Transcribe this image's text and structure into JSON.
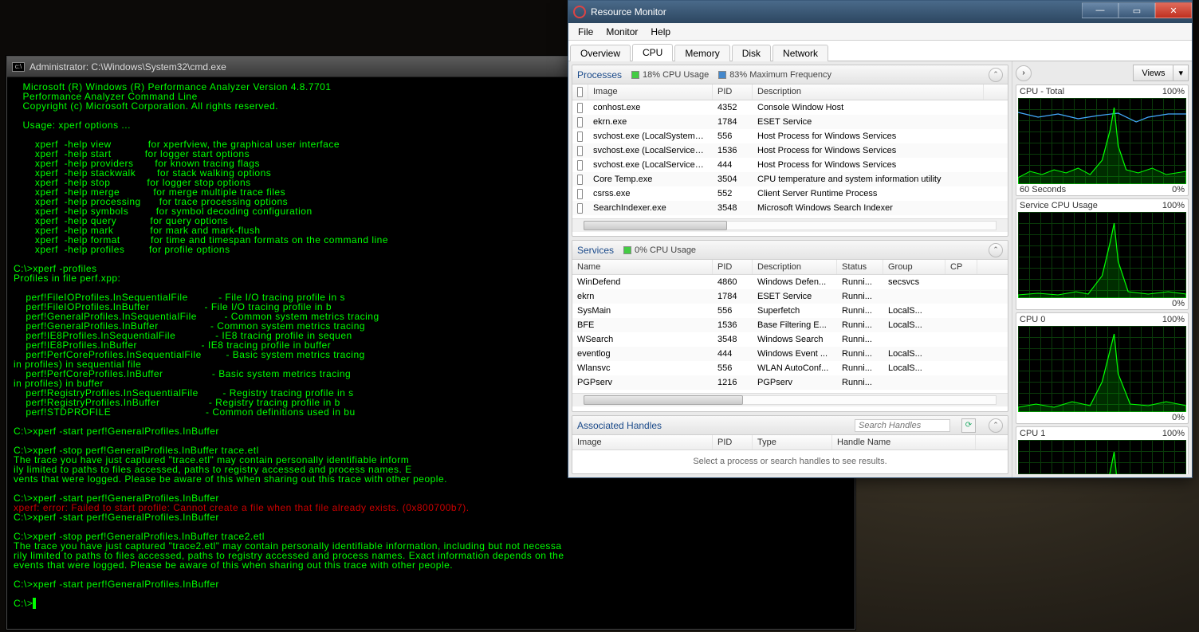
{
  "cmd": {
    "title": "Administrator: C:\\Windows\\System32\\cmd.exe",
    "body": "   Microsoft (R) Windows (R) Performance Analyzer Version 4.8.7701\n   Performance Analyzer Command Line\n   Copyright (c) Microsoft Corporation. All rights reserved.\n\n   Usage: xperf options ...\n\n       xperf  -help view            for xperfview, the graphical user interface\n       xperf  -help start           for logger start options\n       xperf  -help providers       for known tracing flags\n       xperf  -help stackwalk       for stack walking options\n       xperf  -help stop            for logger stop options\n       xperf  -help merge           for merge multiple trace files\n       xperf  -help processing      for trace processing options\n       xperf  -help symbols         for symbol decoding configuration\n       xperf  -help query           for query options\n       xperf  -help mark            for mark and mark-flush\n       xperf  -help format          for time and timespan formats on the command line\n       xperf  -help profiles        for profile options\n\nC:\\>xperf -profiles\nProfiles in file perf.xpp:\n\n    perf!FileIOProfiles.InSequentialFile          - File I/O tracing profile in s\n    perf!FileIOProfiles.InBuffer                  - File I/O tracing profile in b\n    perf!GeneralProfiles.InSequentialFile         - Common system metrics tracing\n    perf!GeneralProfiles.InBuffer                 - Common system metrics tracing\n    perf!IE8Profiles.InSequentialFile             - IE8 tracing profile in sequen\n    perf!IE8Profiles.InBuffer                     - IE8 tracing profile in buffer\n    perf!PerfCoreProfiles.InSequentialFile        - Basic system metrics tracing \nin profiles) in sequential file\n    perf!PerfCoreProfiles.InBuffer                - Basic system metrics tracing \nin profiles) in buffer\n    perf!RegistryProfiles.InSequentialFile        - Registry tracing profile in s\n    perf!RegistryProfiles.InBuffer                - Registry tracing profile in b\n    perf!STDPROFILE                               - Common definitions used in bu\n\nC:\\>xperf -start perf!GeneralProfiles.InBuffer\n\nC:\\>xperf -stop perf!GeneralProfiles.InBuffer trace.etl\nThe trace you have just captured \"trace.etl\" may contain personally identifiable inform\nily limited to paths to files accessed, paths to registry accessed and process names. E\nvents that were logged. Please be aware of this when sharing out this trace with other people.\n\nC:\\>xperf -start perf!GeneralProfiles.InBuffer",
    "err": "xperf: error: Failed to start profile: Cannot create a file when that file already exists. (0x800700b7).",
    "body2": "\nC:\\>xperf -start perf!GeneralProfiles.InBuffer\n\nC:\\>xperf -stop perf!GeneralProfiles.InBuffer trace2.etl\nThe trace you have just captured \"trace2.etl\" may contain personally identifiable information, including but not necessa\nrily limited to paths to files accessed, paths to registry accessed and process names. Exact information depends on the\nevents that were logged. Please be aware of this when sharing out this trace with other people.\n\nC:\\>xperf -start perf!GeneralProfiles.InBuffer\n\nC:\\>"
  },
  "rm": {
    "title": "Resource Monitor",
    "menu": [
      "File",
      "Monitor",
      "Help"
    ],
    "tabs": [
      "Overview",
      "CPU",
      "Memory",
      "Disk",
      "Network"
    ],
    "active_tab": 1,
    "processes": {
      "title": "Processes",
      "metric1": "18% CPU Usage",
      "metric2": "83% Maximum Frequency",
      "headers": [
        "Image",
        "PID",
        "Description"
      ],
      "rows": [
        {
          "img": "conhost.exe",
          "pid": "4352",
          "desc": "Console Window Host"
        },
        {
          "img": "ekrn.exe",
          "pid": "1784",
          "desc": "ESET Service"
        },
        {
          "img": "svchost.exe (LocalSystemNet...",
          "pid": "556",
          "desc": "Host Process for Windows Services"
        },
        {
          "img": "svchost.exe (LocalServiceNo...",
          "pid": "1536",
          "desc": "Host Process for Windows Services"
        },
        {
          "img": "svchost.exe (LocalServiceNet...",
          "pid": "444",
          "desc": "Host Process for Windows Services"
        },
        {
          "img": "Core Temp.exe",
          "pid": "3504",
          "desc": "CPU temperature and system information utility"
        },
        {
          "img": "csrss.exe",
          "pid": "552",
          "desc": "Client Server Runtime Process"
        },
        {
          "img": "SearchIndexer.exe",
          "pid": "3548",
          "desc": "Microsoft Windows Search Indexer"
        }
      ]
    },
    "services": {
      "title": "Services",
      "metric1": "0% CPU Usage",
      "headers": [
        "Name",
        "PID",
        "Description",
        "Status",
        "Group",
        "CP"
      ],
      "rows": [
        {
          "name": "WinDefend",
          "pid": "4860",
          "desc": "Windows Defen...",
          "stat": "Runni...",
          "grp": "secsvcs"
        },
        {
          "name": "ekrn",
          "pid": "1784",
          "desc": "ESET Service",
          "stat": "Runni...",
          "grp": ""
        },
        {
          "name": "SysMain",
          "pid": "556",
          "desc": "Superfetch",
          "stat": "Runni...",
          "grp": "LocalS..."
        },
        {
          "name": "BFE",
          "pid": "1536",
          "desc": "Base Filtering E...",
          "stat": "Runni...",
          "grp": "LocalS..."
        },
        {
          "name": "WSearch",
          "pid": "3548",
          "desc": "Windows Search",
          "stat": "Runni...",
          "grp": ""
        },
        {
          "name": "eventlog",
          "pid": "444",
          "desc": "Windows Event ...",
          "stat": "Runni...",
          "grp": "LocalS..."
        },
        {
          "name": "Wlansvc",
          "pid": "556",
          "desc": "WLAN AutoConf...",
          "stat": "Runni...",
          "grp": "LocalS..."
        },
        {
          "name": "PGPserv",
          "pid": "1216",
          "desc": "PGPserv",
          "stat": "Runni...",
          "grp": ""
        }
      ]
    },
    "handles": {
      "title": "Associated Handles",
      "search_placeholder": "Search Handles",
      "headers": [
        "Image",
        "PID",
        "Type",
        "Handle Name"
      ],
      "msg": "Select a process or search handles to see results."
    },
    "views_label": "Views",
    "graphs": [
      {
        "label": "CPU - Total",
        "right": "100%",
        "foot_l": "60 Seconds",
        "foot_r": "0%"
      },
      {
        "label": "Service CPU Usage",
        "right": "100%",
        "foot_l": "",
        "foot_r": "0%"
      },
      {
        "label": "CPU 0",
        "right": "100%",
        "foot_l": "",
        "foot_r": "0%"
      },
      {
        "label": "CPU 1",
        "right": "100%",
        "foot_l": "",
        "foot_r": ""
      }
    ]
  }
}
